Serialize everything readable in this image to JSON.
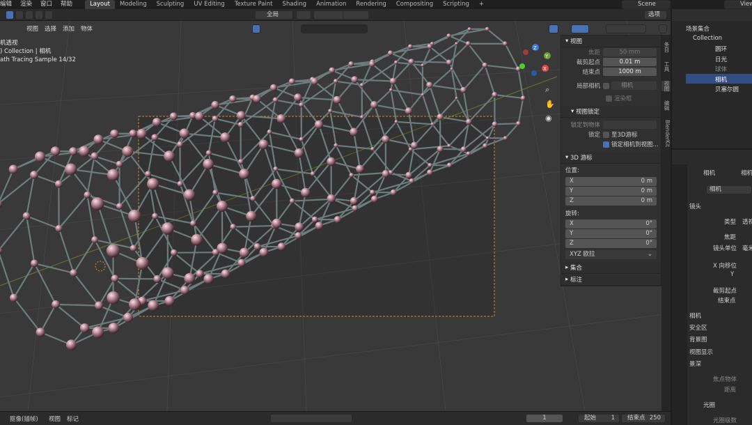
{
  "menu": [
    "编辑",
    "渲染",
    "窗口",
    "帮助"
  ],
  "workspaces": [
    "Layout",
    "Modeling",
    "Sculpting",
    "UV Editing",
    "Texture Paint",
    "Shading",
    "Animation",
    "Rendering",
    "Compositing",
    "Scripting"
  ],
  "add_tab": "+",
  "scene": "Scene",
  "view_layer": "View",
  "header": {
    "global": "全局",
    "options": "选项",
    "view_menu": [
      "视图",
      "选择",
      "添加",
      "物体"
    ]
  },
  "overlay": {
    "line1": "机透视",
    "line2": ") Collection | 相机",
    "line3": "ath Tracing Sample 14/32"
  },
  "npanel": {
    "view_title": "视图",
    "focal_label": "焦距",
    "focal_value": "50 mm",
    "clip_start_label": "截剪起点",
    "clip_start_value": "0.01 m",
    "clip_end_label": "结束点",
    "clip_end_value": "1000 m",
    "local_camera_label": "局部相机",
    "local_camera_value": "相机",
    "render_region": "渲染框",
    "view_lock_title": "视图锁定",
    "lock_to_object": "锁定到物体",
    "lock_label": "锁定",
    "lock_3d_cursor": "至3D游标",
    "lock_camera": "锁定相机到视图...",
    "cursor_title": "3D 游标",
    "location": "位置:",
    "rotation": "旋转:",
    "loc": [
      {
        "axis": "X",
        "value": "0 m"
      },
      {
        "axis": "Y",
        "value": "0 m"
      },
      {
        "axis": "Z",
        "value": "0 m"
      }
    ],
    "rot": [
      {
        "axis": "X",
        "value": "0°"
      },
      {
        "axis": "Y",
        "value": "0°"
      },
      {
        "axis": "Z",
        "value": "0°"
      }
    ],
    "rot_mode": "XYZ 欧拉",
    "collection": "集合",
    "annotation": "标注"
  },
  "vtabs": [
    "条目",
    "工具",
    "视图",
    "编辑",
    "BlenderKit"
  ],
  "outliner": {
    "scene_collection": "场景集合",
    "collection": "Collection",
    "items": [
      "圆环",
      "日光",
      "球体",
      "相机",
      "贝塞尔圆"
    ]
  },
  "props": {
    "camera_tab": "相机",
    "camera_tab2": "相机",
    "data_name": "相机",
    "lens": "镜头",
    "type": "类型",
    "type_value": "透视",
    "focal": "焦距",
    "lens_unit": "镜头单位",
    "lens_unit_value": "毫米",
    "shift_x": "X 向移位",
    "shift_y": "Y",
    "clip_start": "截剪起点",
    "clip_end": "结束点",
    "camera": "相机",
    "safe_area": "安全区",
    "bg_image": "背景图",
    "viewport_display": "视图显示",
    "dof": "景深",
    "focus_object": "焦点物体",
    "distance": "距离",
    "aperture": "光圈",
    "fstop": "光圈级数"
  },
  "timeline": {
    "mode": "抠像(插帧)",
    "view": "视图",
    "marker": "标记",
    "frame": "1",
    "start_label": "起始",
    "start": "1",
    "end_label": "结束点",
    "end": "250"
  }
}
